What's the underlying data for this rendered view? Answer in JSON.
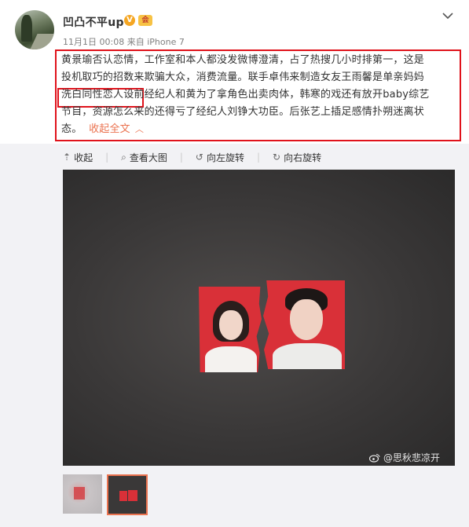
{
  "post": {
    "username": "凹凸不平up",
    "verified_badge": "V",
    "level_badge": "会",
    "time": "11月1日 00:08",
    "source_prefix": "来自",
    "source_device": "iPhone 7",
    "text_line_1": "黄景瑜否认恋情，工作室和本人都没发微博澄清，占了热搜几小时排第一，这是",
    "text_line_2": "投机取巧的招数来欺骗大众，消费流量。联手卓伟来制造女友王雨馨是单亲妈妈",
    "text_line_3_highlight": "洗白同性恋人设",
    "text_line_3_rest": "前经纪人和黄为了拿角色出卖肉体，韩寒的戏还有放开baby综艺",
    "text_line_4": "节目，资源怎么来的还得亏了经纪人刘铮大功臣。后张艺上插足感情扑朔迷离状",
    "text_line_5": "态。",
    "collapse_label": "收起全文",
    "collapse_icon": "chevron-up-icon",
    "more_icon": "chevron-down-icon"
  },
  "toolbar": {
    "collapse": "收起",
    "view_large": "查看大图",
    "rotate_left": "向左旋转",
    "rotate_right": "向右旋转"
  },
  "image": {
    "watermark": "@思秋悲凉开"
  },
  "colors": {
    "accent": "#eb7350",
    "highlight_border": "#e0121b",
    "photo_red": "#d93038"
  }
}
